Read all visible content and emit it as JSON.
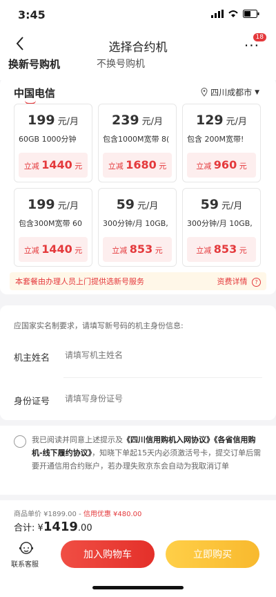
{
  "status_bar": {
    "time": "3:45"
  },
  "header": {
    "title": "选择合约机",
    "back_icon": "chevron-left-icon",
    "more_badge": "18"
  },
  "tabs": [
    {
      "label": "换新号购机"
    },
    {
      "label": "不换号购机"
    }
  ],
  "carrier": {
    "name": "中国电信",
    "location": "四川成都市"
  },
  "plans": [
    {
      "price": "199",
      "unit": "元/月",
      "desc": "60GB 1000分钟",
      "discount_label": "立减",
      "discount": "1440",
      "discount_unit": "元"
    },
    {
      "price": "239",
      "unit": "元/月",
      "desc": "包含1000M宽带 8(",
      "discount_label": "立减",
      "discount": "1680",
      "discount_unit": "元"
    },
    {
      "price": "129",
      "unit": "元/月",
      "desc": "包含 200M宽带!",
      "discount_label": "立减",
      "discount": "960",
      "discount_unit": "元"
    },
    {
      "price": "199",
      "unit": "元/月",
      "desc": "包含300M宽带 60",
      "discount_label": "立减",
      "discount": "1440",
      "discount_unit": "元"
    },
    {
      "price": "59",
      "unit": "元/月",
      "desc": "300分钟/月 10GB,",
      "discount_label": "立减",
      "discount": "853",
      "discount_unit": "元"
    },
    {
      "price": "59",
      "unit": "元/月",
      "desc": "300分钟/月 10GB,",
      "discount_label": "立减",
      "discount": "853",
      "discount_unit": "元"
    }
  ],
  "notice": {
    "text": "本套餐由办理人员上门提供选新号服务",
    "link": "资费详情"
  },
  "form": {
    "hint": "应国家实名制要求，请填写新号码的机主身份信息:",
    "name_label": "机主姓名",
    "name_placeholder": "请填写机主姓名",
    "id_label": "身份证号",
    "id_placeholder": "请填写身份证号"
  },
  "agreement": {
    "prefix": "我已阅读并同意上述提示及",
    "link1": "《四川信用购机入网协议》",
    "link2": "《各省信用购机-线下履约协议》",
    "suffix": "，知晓下单起15天内必须激活号卡，提交订单后需要开通信用合约账户，若办理失败京东会自动为我取消订单"
  },
  "price": {
    "unit_label": "商品单价 ¥1899.00 - ",
    "credit_label": "信用优惠 ¥480.00",
    "total_label": "合计:",
    "total_currency": "¥",
    "total_main": "1419",
    "total_decimal": ".00"
  },
  "bottom": {
    "service_label": "联系客服",
    "cart_button": "加入购物车",
    "buy_button": "立即购买"
  },
  "colors": {
    "accent": "#e4393c",
    "buy": "#f8b92e",
    "notice_bg": "#fff7e8"
  }
}
